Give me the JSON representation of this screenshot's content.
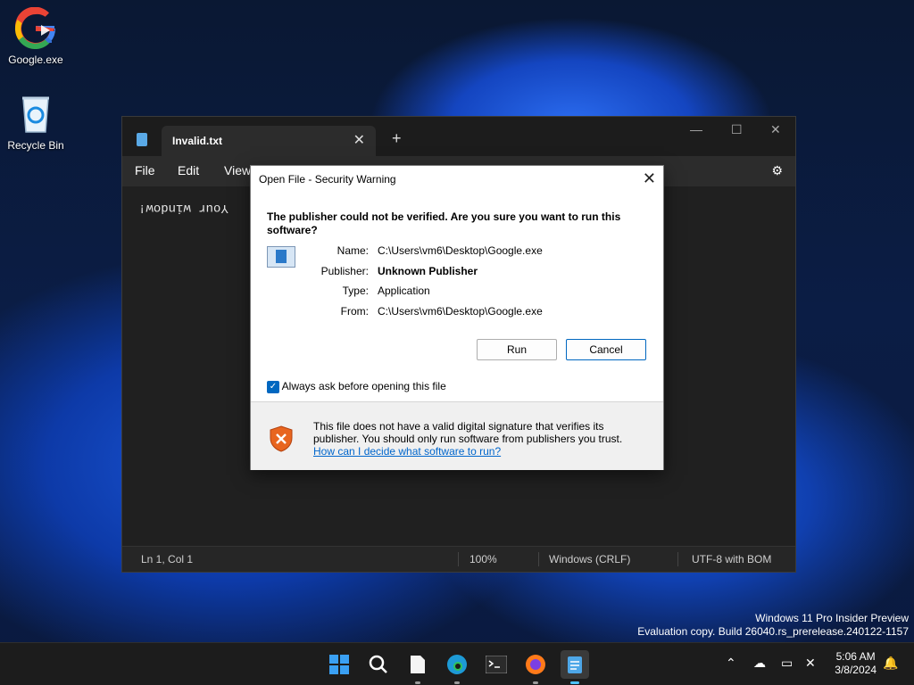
{
  "desktop": {
    "icons": [
      {
        "label": "Google.exe",
        "icon": "google-icon"
      },
      {
        "label": "Recycle Bin",
        "icon": "recycle-bin-icon"
      }
    ]
  },
  "notepad": {
    "tab_title": "Invalid.txt",
    "menu": [
      "File",
      "Edit",
      "View"
    ],
    "content": "Your window!",
    "status": {
      "position": "Ln 1, Col 1",
      "zoom": "100%",
      "line_ending": "Windows (CRLF)",
      "encoding": "UTF-8 with BOM"
    }
  },
  "dialog": {
    "title": "Open File - Security Warning",
    "headline": "The publisher could not be verified.  Are you sure you want to run this software?",
    "fields": [
      {
        "key": "Name:",
        "value": "C:\\Users\\vm6\\Desktop\\Google.exe",
        "bold": false
      },
      {
        "key": "Publisher:",
        "value": "Unknown Publisher",
        "bold": true
      },
      {
        "key": "Type:",
        "value": "Application",
        "bold": false
      },
      {
        "key": "From:",
        "value": "C:\\Users\\vm6\\Desktop\\Google.exe",
        "bold": false
      }
    ],
    "run_label": "Run",
    "cancel_label": "Cancel",
    "checkbox_label": "Always ask before opening this file",
    "checkbox_checked": true,
    "footer_text": "This file does not have a valid digital signature that verifies its publisher.  You should only run software from publishers you trust.",
    "footer_link": "How can I decide what software to run?"
  },
  "watermark": {
    "line1": "Windows 11 Pro Insider Preview",
    "line2": "Evaluation copy. Build 26040.rs_prerelease.240122-1157"
  },
  "taskbar": {
    "apps": [
      "start-icon",
      "search-icon",
      "file-explorer-icon",
      "edge-icon",
      "terminal-icon",
      "firefox-icon",
      "notepad-icon"
    ],
    "time": "5:06 AM",
    "date": "3/8/2024"
  },
  "colors": {
    "accent": "#0067c0",
    "link": "#0066cc",
    "shield": "#e8651f"
  }
}
